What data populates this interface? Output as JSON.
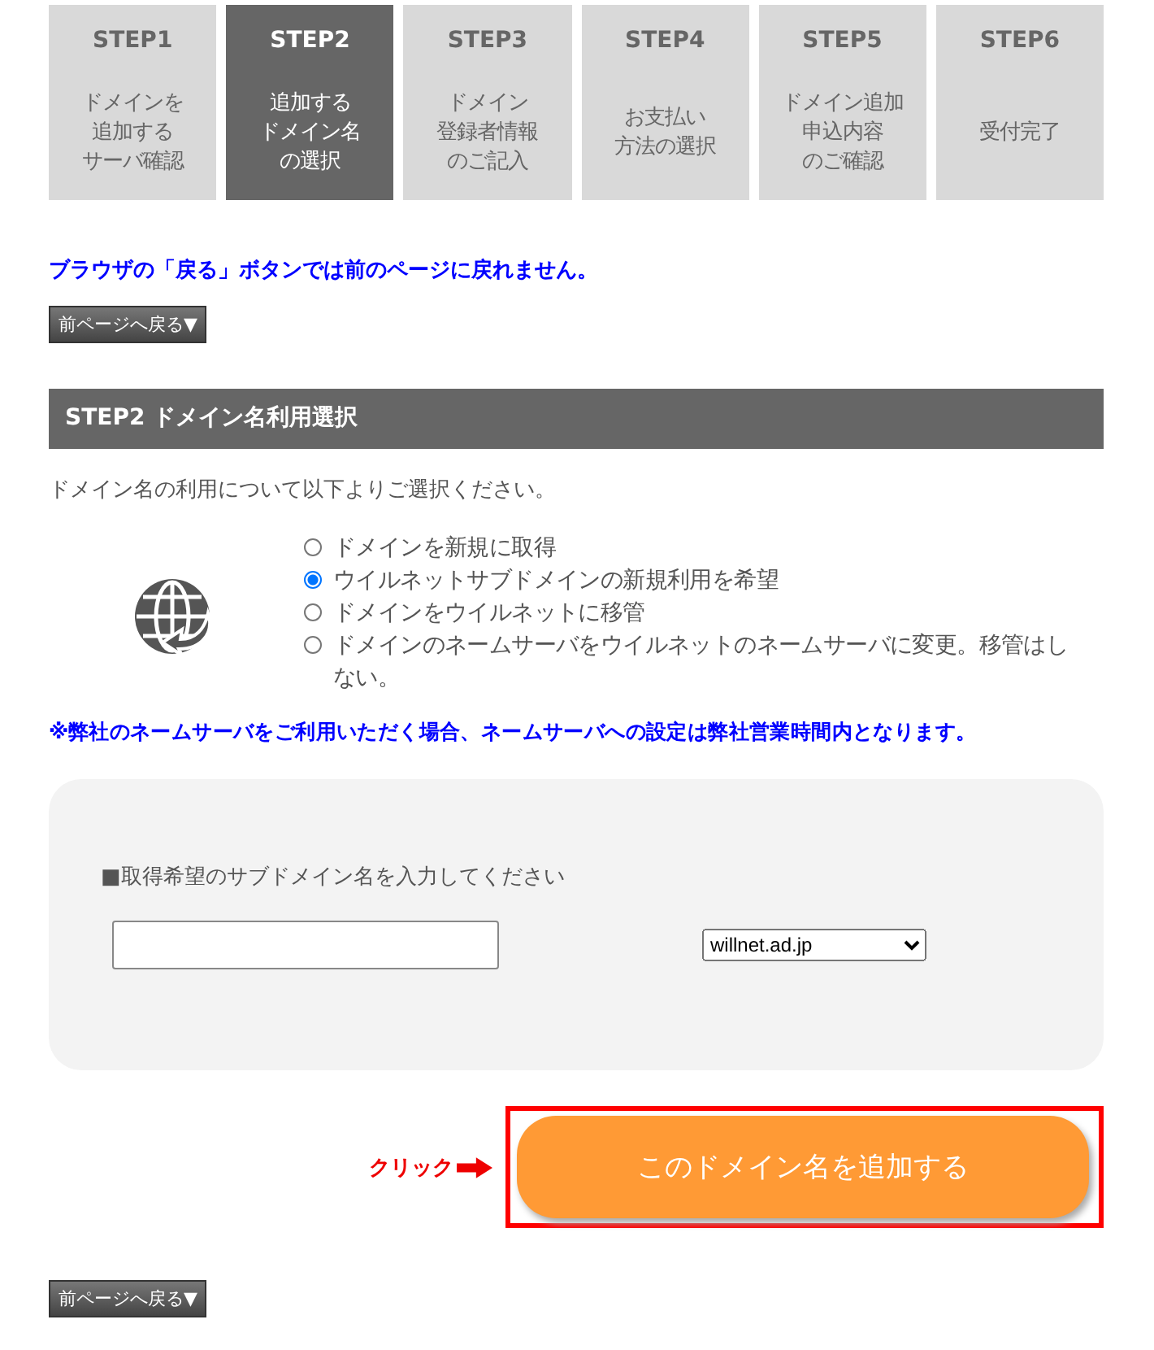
{
  "steps": [
    {
      "label": "STEP1",
      "lines": [
        "ドメインを",
        "追加する",
        "サーバ確認"
      ],
      "selected": false
    },
    {
      "label": "STEP2",
      "lines": [
        "追加する",
        "ドメイン名",
        "の選択"
      ],
      "selected": true
    },
    {
      "label": "STEP3",
      "lines": [
        "ドメイン",
        "登録者情報",
        "のご記入"
      ],
      "selected": false
    },
    {
      "label": "STEP4",
      "lines": [
        "お支払い",
        "方法の選択"
      ],
      "selected": false
    },
    {
      "label": "STEP5",
      "lines": [
        "ドメイン追加",
        "申込内容",
        "のご確認"
      ],
      "selected": false
    },
    {
      "label": "STEP6",
      "lines": [
        "受付完了"
      ],
      "selected": false
    }
  ],
  "warning": "ブラウザの「戻る」ボタンでは前のページに戻れません。",
  "back_button_top": "前ページへ戻る▼",
  "section_title": "STEP2 ドメイン名利用選択",
  "intro": "ドメイン名の利用について以下よりご選択ください。",
  "options": [
    {
      "label": "ドメインを新規に取得",
      "selected": false
    },
    {
      "label": "ウイルネットサブドメインの新規利用を希望",
      "selected": true
    },
    {
      "label": "ドメインをウイルネットに移管",
      "selected": false
    },
    {
      "label": "ドメインのネームサーバをウイルネットのネームサーバに変更。移管はしない。",
      "selected": false
    }
  ],
  "note": "※弊社のネームサーバをご利用いただく場合、ネームサーバへの設定は弊社営業時間内となります。",
  "form": {
    "label": "■取得希望のサブドメイン名を入力してください",
    "domain_select": "willnet.ad.jp"
  },
  "click_hint": "クリック",
  "submit_button": "このドメイン名を追加する",
  "back_button_bottom": "前ページへ戻る▼"
}
